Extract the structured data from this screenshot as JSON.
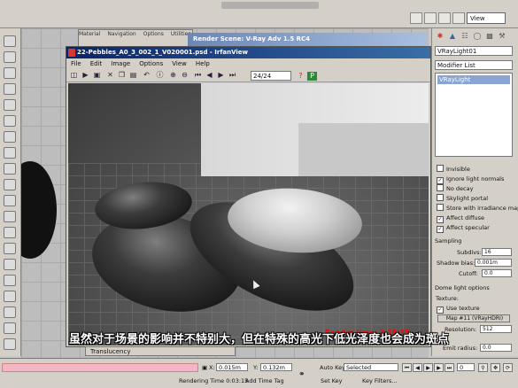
{
  "toolbar": {
    "view_select": "View"
  },
  "material_editor": {
    "tabs": [
      "Material",
      "Navigation",
      "Options",
      "Utilities"
    ]
  },
  "render_scene": {
    "title": "Render Scene: V-Ray Adv 1.5 RC4"
  },
  "irfanview": {
    "title": "22-Pebbles_A0_3_002_1_V020001.psd - IrfanView",
    "menu": [
      "File",
      "Edit",
      "Image",
      "Options",
      "View",
      "Help"
    ],
    "page_counter": "24/24",
    "render_time": "Render time: 2:18:35"
  },
  "command_panel": {
    "object_name": "VRayLight01",
    "modifier_list": "Modifier List",
    "stack_item": "VRayLight",
    "options": [
      {
        "label": "Invisible",
        "checked": false
      },
      {
        "label": "Ignore light normals",
        "checked": true
      },
      {
        "label": "No decay",
        "checked": false
      },
      {
        "label": "Skylight portal",
        "checked": false
      },
      {
        "label": "Store with irradiance map",
        "checked": false
      },
      {
        "label": "Affect diffuse",
        "checked": true
      },
      {
        "label": "Affect specular",
        "checked": true
      }
    ],
    "sampling": {
      "header": "Sampling",
      "subdivs_label": "Subdivs:",
      "subdivs": "16",
      "shadow_bias_label": "Shadow bias:",
      "shadow_bias": "0.001m",
      "cutoff_label": "Cutoff:",
      "cutoff": "0.0"
    },
    "dome": {
      "header": "Dome light options",
      "texture_label": "Texture:",
      "use_texture": "Use texture",
      "map": "Map #11  (VRayHDRI)",
      "resolution_label": "Resolution:",
      "resolution": "512",
      "emit_radius_label": "Emit radius:",
      "emit_radius": "0.0"
    }
  },
  "bottom": {
    "translucency": "Translucency",
    "x_label": "X:",
    "x_value": "0.015m",
    "y_label": "Y:",
    "y_value": "0.132m",
    "rendering_time": "Rendering Time  0:03:15",
    "add_time_tag": "Add Time Tag",
    "auto_key": "Auto Key",
    "set_key": "Set Key",
    "selected": "Selected",
    "key_filters": "Key Filters...",
    "frame": "0"
  },
  "subtitle": "虽然对于场景的影响并不特别大，但在特殊的高光下低光泽度也会成为斑点",
  "colors": {
    "render_time_text": "#e01010",
    "title_bar": "#0a246a"
  }
}
